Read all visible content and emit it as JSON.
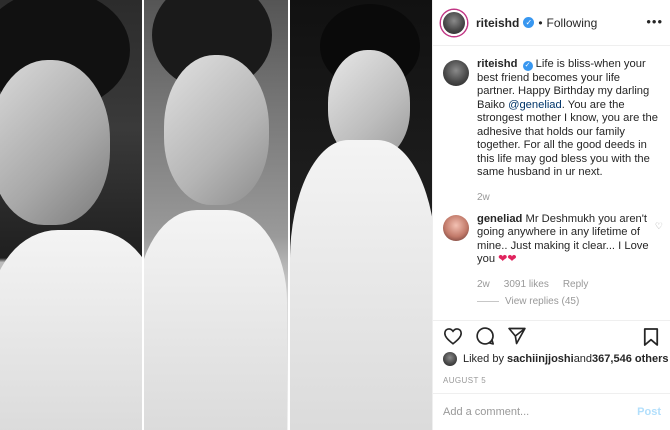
{
  "post": {
    "author": "riteishd",
    "follow_status": "Following",
    "separator": "•",
    "more_glyph": "•••"
  },
  "caption": {
    "username": "riteishd",
    "text_a": "Life is bliss-when your best friend becomes your life partner. Happy Birthday my darling Baiko ",
    "mention": "@geneliad",
    "text_b": ". You are the strongest mother I know, you are the adhesive that holds our family together. For all the good deeds in this life may god bless you with the same husband in ur next.",
    "age": "2w"
  },
  "reply": {
    "username": "geneliad",
    "text": "Mr Deshmukh you aren't going anywhere in any lifetime of mine.. Just making it clear... I Love you",
    "hearts": "❤❤",
    "age": "2w",
    "likes": "3091 likes",
    "reply_label": "Reply",
    "view_replies": "View replies (45)"
  },
  "likes": {
    "prefix": "Liked by ",
    "user": "sachiinjjoshi",
    "middle": " and ",
    "count": "367,546 others"
  },
  "date": "AUGUST 5",
  "comment_box": {
    "placeholder": "Add a comment...",
    "post_label": "Post"
  },
  "colors": {
    "verified": "#3897f0",
    "link": "#003569",
    "heart": "#e0245e",
    "post_disabled": "#b2dffc"
  }
}
